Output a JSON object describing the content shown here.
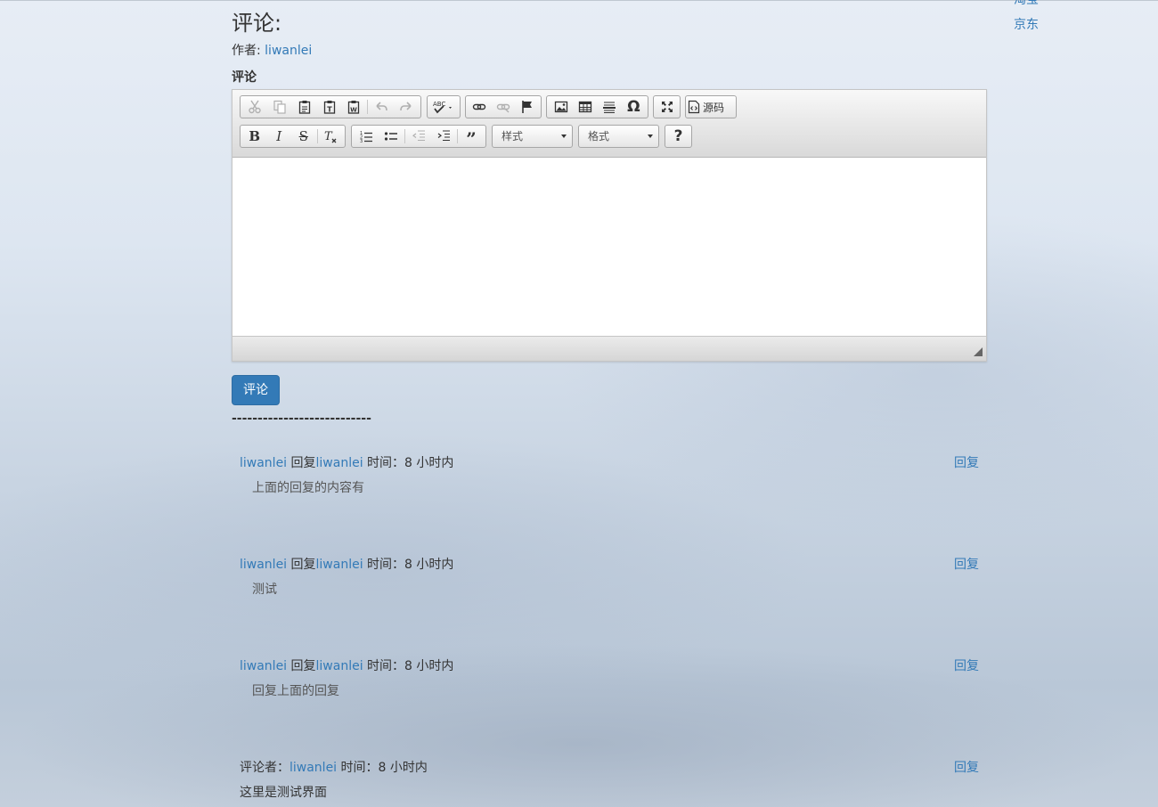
{
  "external_links": [
    "淘宝",
    "京东"
  ],
  "page": {
    "title": "评论:",
    "author_prefix": "作者: ",
    "author_name": "liwanlei",
    "form_label": "评论",
    "submit_label": "评论",
    "divider": "---------------------------"
  },
  "editor": {
    "toolbar_row1": [
      "cut-icon",
      "copy-icon",
      "paste-icon",
      "paste-text-icon",
      "paste-word-icon",
      "undo-icon",
      "redo-icon",
      "spellcheck-icon",
      "link-icon",
      "unlink-icon",
      "anchor-icon",
      "image-icon",
      "table-icon",
      "horizontal-rule-icon",
      "special-char-icon",
      "maximize-icon",
      "source-icon"
    ],
    "source_label": "源码",
    "toolbar_row2": [
      "bold-icon",
      "italic-icon",
      "strike-icon",
      "remove-format-icon",
      "numbered-list-icon",
      "bulleted-list-icon",
      "outdent-icon",
      "indent-icon",
      "blockquote-icon",
      "help-icon"
    ],
    "styles_combo": "样式",
    "format_combo": "格式"
  },
  "comments": [
    {
      "user": "liwanlei",
      "reply_word": " 回复",
      "reply_to": "liwanlei",
      "time": " 时间：8 小时内",
      "content": "上面的回复的内容有",
      "reply_label": "回复"
    },
    {
      "user": "liwanlei",
      "reply_word": " 回复",
      "reply_to": "liwanlei",
      "time": " 时间：8 小时内",
      "content": "测试",
      "reply_label": "回复"
    },
    {
      "user": "liwanlei",
      "reply_word": " 回复",
      "reply_to": "liwanlei",
      "time": " 时间：8 小时内",
      "content": "回复上面的回复",
      "reply_label": "回复"
    }
  ],
  "root_comment": {
    "prefix": "评论者：",
    "user": "liwanlei",
    "time": " 时间：8 小时内",
    "content": "这里是测试界面",
    "reply_label": "回复"
  },
  "colors": {
    "link": "#337ab7",
    "button": "#337ab7"
  }
}
